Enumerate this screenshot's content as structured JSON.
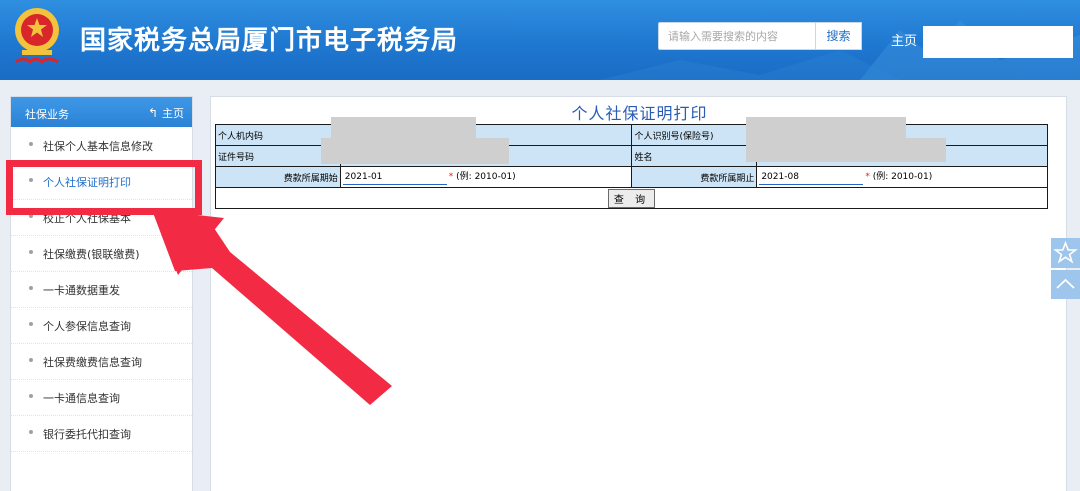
{
  "header": {
    "site_title": "国家税务总局厦门市电子税务局",
    "search_placeholder": "请输入需要搜索的内容",
    "search_button": "搜索",
    "home_link": "主页"
  },
  "sidebar": {
    "title": "社保业务",
    "home": "主页",
    "items": [
      {
        "label": "社保个人基本信息修改"
      },
      {
        "label": "个人社保证明打印"
      },
      {
        "label": "校正个人社保基本"
      },
      {
        "label": "社保缴费(银联缴费)"
      },
      {
        "label": "一卡通数据重发"
      },
      {
        "label": "个人参保信息查询"
      },
      {
        "label": "社保费缴费信息查询"
      },
      {
        "label": "一卡通信息查询"
      },
      {
        "label": "银行委托代扣查询"
      }
    ]
  },
  "form": {
    "title": "个人社保证明打印",
    "personal_code_label": "个人机内码",
    "insurance_id_label": "个人识别号(保险号)",
    "id_number_label": "证件号码",
    "name_label": "姓名",
    "period_start_label": "费款所属期始",
    "period_start_value": "2021-01",
    "period_start_hint": "(例: 2010-01)",
    "period_end_label": "费款所属期止",
    "period_end_value": "2021-08",
    "period_end_hint": "(例: 2010-01)",
    "required_mark": "*",
    "query_button": "查 询"
  },
  "colors": {
    "header_blue": "#1f78d0",
    "highlight_red": "#f22a44",
    "title_blue": "#2a5bb5"
  }
}
